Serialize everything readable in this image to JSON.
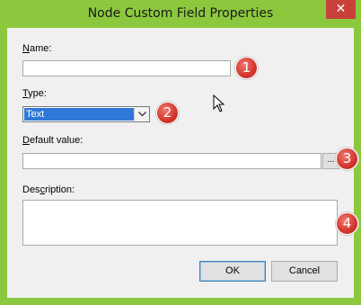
{
  "window": {
    "title": "Node Custom Field Properties",
    "close_glyph": "✕"
  },
  "form": {
    "name": {
      "accesskey": "N",
      "label_rest": "ame:",
      "value": ""
    },
    "type": {
      "accesskey": "T",
      "label_rest": "ype:",
      "selected": "Text"
    },
    "default_value": {
      "accesskey": "D",
      "label_rest": "efault value:",
      "value": "",
      "browse_label": "..."
    },
    "description": {
      "label_prefix": "Des",
      "accesskey": "c",
      "label_rest": "ription:",
      "value": ""
    }
  },
  "markers": [
    "1",
    "2",
    "3",
    "4"
  ],
  "buttons": {
    "ok": "OK",
    "cancel": "Cancel"
  },
  "colors": {
    "frame": "#8cc83e",
    "close": "#c7413a",
    "marker": "#d2342b",
    "selection": "#3078d7"
  }
}
